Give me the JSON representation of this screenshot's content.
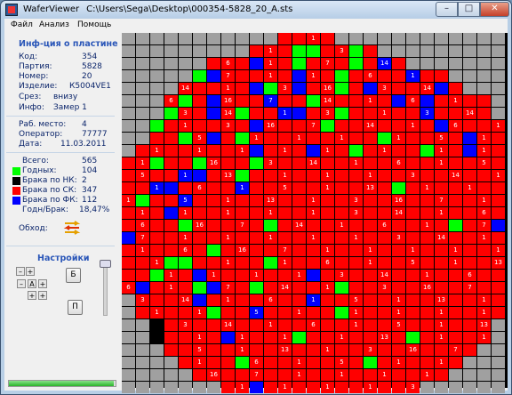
{
  "window": {
    "app_name": "WaferViewer",
    "path": "C:\\Users\\Sega\\Desktop\\000354-5828_20_A.sts",
    "minimize": "–",
    "maximize": "□",
    "close": "✕"
  },
  "menu": [
    "Файл",
    "Анализ",
    "Помощь"
  ],
  "info": {
    "title": "Инф-ция о пластине",
    "code_label": "Код:",
    "code": "354",
    "batch_label": "Партия:",
    "batch": "5828",
    "number_label": "Номер:",
    "number": "20",
    "product_label": "Изделие:",
    "product": "К5004VE1",
    "cut_label": "Срез:",
    "cut": "внизу",
    "infotext_label": "Инфо:",
    "infotext": "Замер 1",
    "workplace_label": "Раб. место:",
    "workplace": "4",
    "operator_label": "Оператор:",
    "operator": "77777",
    "date_label": "Дата:",
    "date": "11.03.2011",
    "total_label": "Всего:",
    "total": "565",
    "good_label": "Годных:",
    "good": "104",
    "nk_label": "Брака по НК:",
    "nk": "2",
    "sk_label": "Брака по СК:",
    "sk": "347",
    "fk_label": "Брака по ФК:",
    "fk": "112",
    "ratio_label": "Годн/Брак:",
    "ratio": "18,47%",
    "bypass_label": "Обход:"
  },
  "settings": {
    "title": "Настройки",
    "minus": "–",
    "plus": "+",
    "a": "A",
    "b_button": "Б",
    "p_button": "П"
  },
  "progress": {
    "value": 1.0
  },
  "colors": {
    "good": "#00ff00",
    "nk": "#000000",
    "sk": "#ff0000",
    "fk": "#0000ff",
    "empty": "#a0a0a0",
    "window_bg": "#f0f0f0",
    "info_text": "#0a246a",
    "title_text": "#2a56b8"
  },
  "wafer_map": {
    "cols": 27,
    "rows": 29,
    "grid": [
      "...........RRRR............",
      ".........RRRGGRRGR.........",
      "......RRRBRRGRRRGRBR.......",
      ".....GBRRRRRBRRGRRRRBRR....",
      "....RRRRRBGRBRRGRBRRRRBR...",
      "...RGRBRRRBRRGRRRRRBRBRRRR..",
      "...GRRBRGRRBBRRGRRRRRBRRRR..",
      "..GRRRRRRBRRRRGRRRRRRRBRRRR.",
      "..RRGRBRGRRRRRRRRRGRRRRRBRR.",
      ".RRRRRRRRBRRRBRRGRRRRGRRBRRR",
      "RRGRRGRRRGRRRRRRRRRRRRRRRRRR",
      "RRRRBBRRGRRRRRRRRRRRRRRRRRRR",
      "RRBBRRRRBRRRRRRRRRRGRRRRRRRR",
      "RGRRBRRRRRRRRRRRRRRRRRRRRRRR",
      "RRRBRRRRRRRRRRRRRRRRRRRRRRRB",
      "RRRRGRRRRRGRRRRRRRRRRRRGRRBR",
      "BRRRRRRRRRRRRRRRRRRRRRRRRRRR",
      "RRRRRRGRRRRRRRRRRRRRRRRRRRRR",
      "RRRGGRRRRRGRRRRRRRRRRRRRRRRR",
      "RRGRRBRRRRRRRBRRRRRRRRRRRRRR",
      "RBRRRGBRRGRRRRRGRRRRRRRRRRRR",
      ".RRRRBRRRRRRRBRRRRRRRRRRRRR.",
      ".RRRRRGRRBRRRRRGRRRRRRRRRRR.",
      "..KRRRRRRRRRRRRRRRRRRRRRRR..",
      "..KRRRRBRRRRGRRRRRRRGRRRRR..",
      "...RRRRRRRRRRRRRRRRRRRRRR...",
      "....RRRRGRRRRRRRRGRRRRRR....",
      ".....RRRRRRRRRRRRRRRRRR.....",
      ".......RRBRRRRRRRRRRR......."
    ]
  }
}
